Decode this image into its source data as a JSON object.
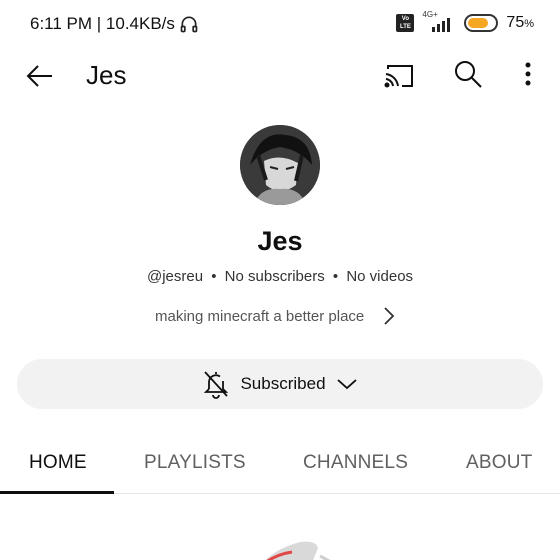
{
  "status": {
    "time_speed": "6:11 PM | 10.4KB/s",
    "volte": "Vo LTE",
    "network": "4G+",
    "battery_percent": "75",
    "battery_unit": "%",
    "battery_level": 0.75
  },
  "appbar": {
    "title": "Jes"
  },
  "channel": {
    "name": "Jes",
    "handle": "@jesreu",
    "subscribers": "No subscribers",
    "videos": "No videos",
    "separator": "•",
    "description": "making minecraft a better place"
  },
  "subscribe": {
    "label": "Subscribed"
  },
  "tabs": [
    {
      "label": "HOME"
    },
    {
      "label": "PLAYLISTS"
    },
    {
      "label": "CHANNELS"
    },
    {
      "label": "ABOUT"
    }
  ],
  "colors": {
    "battery": "#f5a623",
    "button_bg": "#f2f2f2",
    "text": "#0f0f0f"
  }
}
